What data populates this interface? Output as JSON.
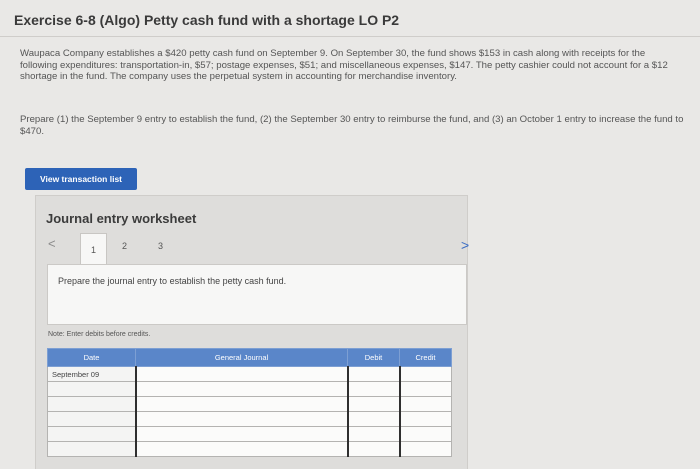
{
  "page": {
    "title": "Exercise 6-8 (Algo) Petty cash fund with a shortage LO P2",
    "paragraph1": "Waupaca Company establishes a $420 petty cash fund on September 9. On September 30, the fund shows $153 in cash along with receipts for the following expenditures: transportation-in, $57; postage expenses, $51; and miscellaneous expenses, $147. The petty cashier could not account for a $12 shortage in the fund. The company uses the perpetual system in accounting for merchandise inventory.",
    "paragraph2": "Prepare (1) the September 9 entry to establish the fund, (2) the September 30 entry to reimburse the fund, and (3) an October 1 entry to increase the fund to $470.",
    "view_transactions_label": "View transaction list"
  },
  "worksheet": {
    "title": "Journal entry worksheet",
    "prev_arrow": "<",
    "next_arrow": ">",
    "tabs": [
      "1",
      "2",
      "3"
    ],
    "active_tab": "1",
    "prompt": "Prepare the journal entry to establish the petty cash fund.",
    "note": "Note: Enter debits before credits.",
    "table": {
      "headers": [
        "Date",
        "General Journal",
        "Debit",
        "Credit"
      ],
      "rows": [
        [
          "September 09",
          "",
          "",
          ""
        ],
        [
          "",
          "",
          "",
          ""
        ],
        [
          "",
          "",
          "",
          ""
        ],
        [
          "",
          "",
          "",
          ""
        ],
        [
          "",
          "",
          "",
          ""
        ],
        [
          "",
          "",
          "",
          ""
        ]
      ]
    }
  },
  "colors": {
    "button_bg": "#2d63b7",
    "table_header_bg": "#5a86c9",
    "page_bg": "#e9e8e6"
  }
}
